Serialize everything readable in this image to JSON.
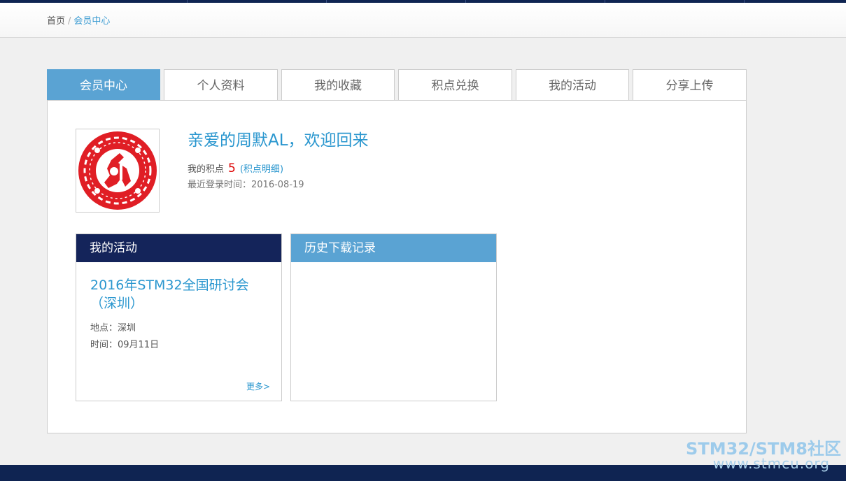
{
  "breadcrumb": {
    "home": "首页",
    "separator": "/",
    "current": "会员中心"
  },
  "tabs": [
    {
      "label": "会员中心",
      "active": true
    },
    {
      "label": "个人资料",
      "active": false
    },
    {
      "label": "我的收藏",
      "active": false
    },
    {
      "label": "积点兑换",
      "active": false
    },
    {
      "label": "我的活动",
      "active": false
    },
    {
      "label": "分享上传",
      "active": false
    }
  ],
  "profile": {
    "welcome": "亲爱的周默AL，欢迎回来",
    "points_label": "我的积点",
    "points_value": "5",
    "points_detail": "积点明细",
    "last_login": "最近登录时间：2016-08-19"
  },
  "activity_box": {
    "title": "我的活动",
    "event_title": "2016年STM32全国研讨会（深圳）",
    "location": "地点：深圳",
    "time": "时间：09月11日",
    "more": "更多>"
  },
  "download_box": {
    "title": "历史下载记录"
  },
  "watermark": {
    "brand": "STM32/STM8社区",
    "url": "www.stmcu.org"
  },
  "colors": {
    "navy": "#14245a",
    "accent_blue": "#5aa3d3",
    "link_blue": "#2b97cf",
    "points_red": "#dd0000",
    "avatar_red": "#e01e25"
  },
  "icons": {
    "avatar": "red-seal-avatar"
  }
}
